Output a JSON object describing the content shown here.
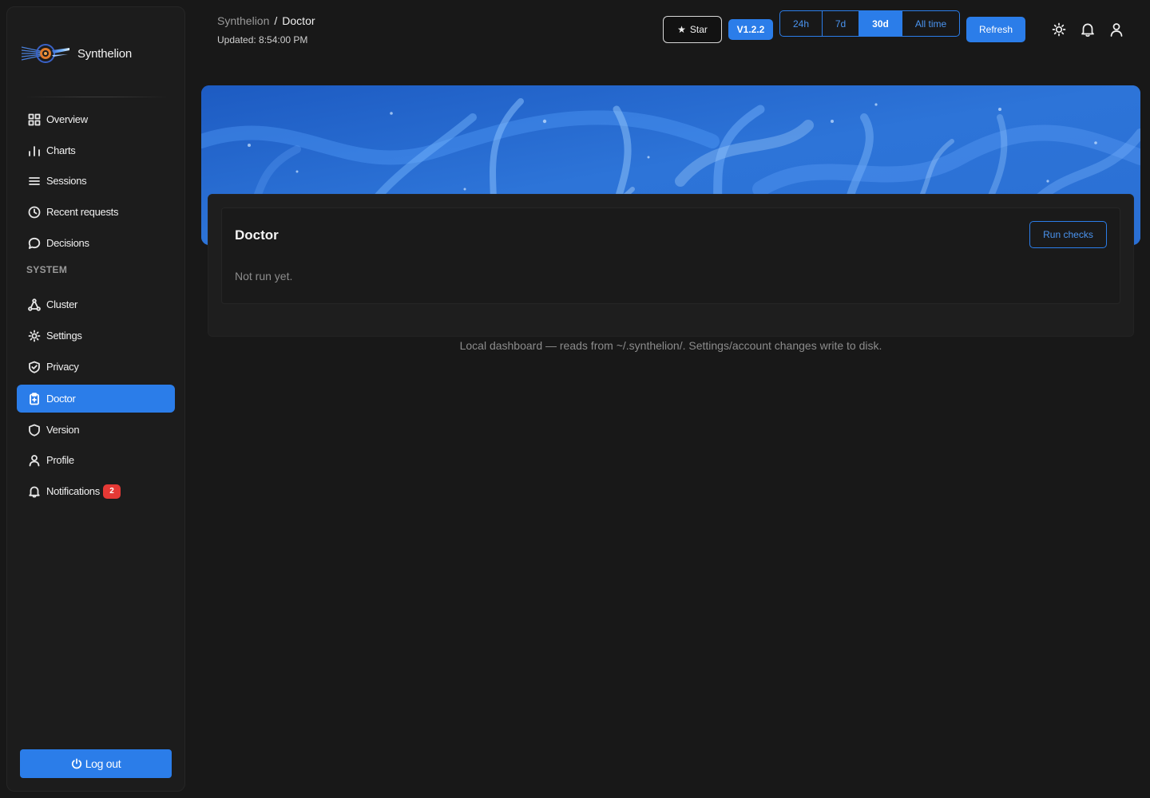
{
  "app": {
    "name": "Synthelion"
  },
  "sidebar": {
    "items": [
      {
        "label": "Overview",
        "icon": "grid-icon"
      },
      {
        "label": "Charts",
        "icon": "bar-chart-icon"
      },
      {
        "label": "Sessions",
        "icon": "list-icon"
      },
      {
        "label": "Recent requests",
        "icon": "clock-icon"
      },
      {
        "label": "Decisions",
        "icon": "chat-bubble-icon"
      }
    ],
    "section_label": "SYSTEM",
    "system_items": [
      {
        "label": "Cluster",
        "icon": "network-icon"
      },
      {
        "label": "Settings",
        "icon": "sun-gear-icon"
      },
      {
        "label": "Privacy",
        "icon": "shield-check-icon"
      },
      {
        "label": "Doctor",
        "icon": "clipboard-medical-icon",
        "active": true
      },
      {
        "label": "Version",
        "icon": "shield-icon"
      },
      {
        "label": "Profile",
        "icon": "user-icon"
      },
      {
        "label": "Notifications",
        "icon": "bell-icon",
        "badge": "2"
      }
    ],
    "logout_label": "Log out"
  },
  "header": {
    "breadcrumb_root": "Synthelion",
    "breadcrumb_sep": "/",
    "breadcrumb_current": "Doctor",
    "updated": "Updated: 8:54:00 PM",
    "star_label": "Star",
    "version": "V1.2.2",
    "ranges": [
      "24h",
      "7d",
      "30d",
      "All time"
    ],
    "active_range": "30d",
    "refresh_label": "Refresh"
  },
  "doctor": {
    "title": "Doctor",
    "run_label": "Run checks",
    "status": "Not run yet."
  },
  "footer": {
    "note": "Local dashboard — reads from ~/.synthelion/. Settings/account changes write to disk."
  },
  "colors": {
    "accent": "#2b7de9",
    "background": "#181818",
    "badge": "#e53935"
  }
}
